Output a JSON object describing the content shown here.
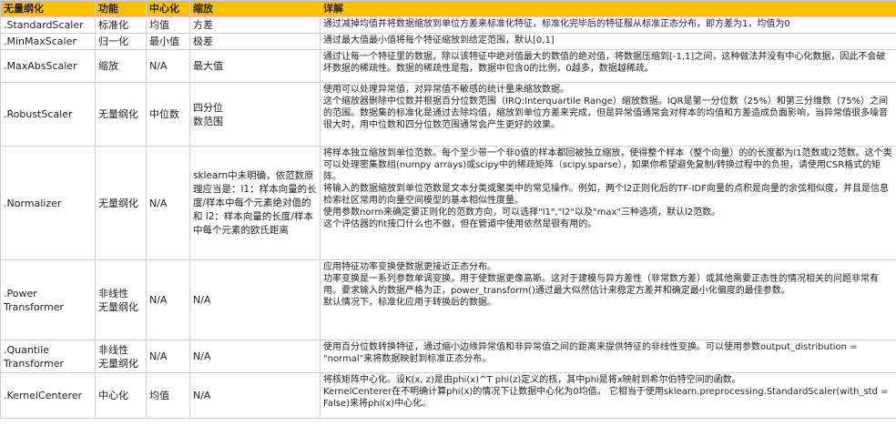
{
  "header": {
    "col1": "无量纲化",
    "col2": "功能",
    "col3": "中心化",
    "col4": "缩放",
    "col5": "详解"
  },
  "rows": [
    {
      "method": ".StandardScaler",
      "func": "标准化",
      "center": "均值",
      "scale": "方差",
      "detail": [
        "通过减掉均值并将数据缩放到单位方差来标准化特征，标准化完毕后的特征服从标准正态分布，即方差为1，均值为0"
      ]
    },
    {
      "method": ".MinMaxScaler",
      "func": "归一化",
      "center": "最小值",
      "scale": "极差",
      "detail": [
        "通过最大值最小值将每个特征缩放到给定范围，默认[0,1]"
      ]
    },
    {
      "method": ".MaxAbsScaler",
      "func": "缩放",
      "center": "N/A",
      "scale": "最大值",
      "detail": [
        "通过让每一个特征里的数据，除以该特征中绝对值最大的数值的绝对值，将数据压缩到[-1,1]之间，这种做法并没有中心化数据，因此不会破坏数据的稀疏性。数据的稀疏性是指，数据中包含0的比例，0越多，数据越稀疏。"
      ]
    },
    {
      "method": ".RobustScaler",
      "func": "无量纲化",
      "center": "中位数",
      "scale_lines": [
        "四分位",
        "数范围"
      ],
      "detail": [
        "使用可以处理异常值，对异常值不敏感的统计量来缩放数据。",
        "这个缩放器删除中位数并根据百分位数范围（IRQ:Interquartile Range）缩放数据。IQR是第一分位数（25%）和第三分维数（75%）之间的范围。数据集的标准化是通过去除均值，缩放到单位方差来完成，但是异常值通常会对样本的均值和方差造成负面影响，当异常值很多噪音很大时，用中位数和四分位数范围通常会产生更好的效果。"
      ]
    },
    {
      "method": ".Normalizer",
      "func": "无量纲化",
      "center": "N/A",
      "scale": "sklearn中未明确，依范数原理应当是：l1：样本向量的长度/样本中每个元素绝对值的和 l2：样本向量的长度/样本中每个元素的欧氏距离",
      "detail": [
        "将样本独立缩放到单位范数。每个至少带一个非0值的样本都回被独立缩放，使得整个样本（整个向量）的的长度都为l1范数或l2范数。这个类可以处理密集数组(numpy arrays)或scipy中的稀疏矩阵（scipy.sparse），如果你希望避免复制/转换过程中的负担，请使用CSR格式的矩阵。",
        "将输入的数据缩放到单位范数是文本分类或聚类中的常见操作。例如，两个l2正则化后的TF-IDF向量的点积是向量的余弦相似度，并且是信息检索社区常用的向量空间模型的基本相似性度量。",
        "使用参数norm来确定要正则化的范数方向，可以选择\"l1\",\"l2\"以及\"max\"三种选项，默认l2范数。",
        "这个评估器的fit接口什么也不做，但在管道中使用依然是很有用的。"
      ]
    },
    {
      "method_lines": [
        ".Power",
        "Transformer"
      ],
      "func_lines": [
        "非线性",
        "无量纲化"
      ],
      "center": "N/A",
      "scale": "N/A",
      "detail": [
        "应用特征功率变换使数据更接近正态分布。",
        "功率变换是一系列参数单调变换，用于使数据更像高斯。这对于建模与异方差性（非常数方差）或其他需要正态性的情况相关的问题非常有用。要求输入的数据严格为正，power_transform()通过最大似然估计来稳定方差并和确定最小化偏度的最佳参数。",
        "默认情况下，标准化应用于转换后的数据。"
      ]
    },
    {
      "method_lines": [
        ".Quantile",
        "Transformer"
      ],
      "func_lines": [
        "非线性",
        "无量纲化"
      ],
      "center": "N/A",
      "scale": "N/A",
      "detail": [
        "使用百分位数转换特征，通过缩小边缘异常值和非异常值之间的距离来提供特征的非线性变换。可以使用参数output_distribution = \"normal\"来将数据映射到标准正态分布。"
      ]
    },
    {
      "method": ".KernelCenterer",
      "func": "中心化",
      "center": "均值",
      "scale": "N/A",
      "detail": [
        "将核矩阵中心化。设K(x, z)是由phi(x)^T phi(z)定义的核，其中phi是将x映射到希尔伯特空间的函数。",
        "KernelCenterer在不明确计算phi(x)的情况下让数据中心化为0均值。 它相当于使用sklearn.preprocessing.StandardScaler(with_std = False)来将phi(x)中心化。"
      ]
    }
  ]
}
